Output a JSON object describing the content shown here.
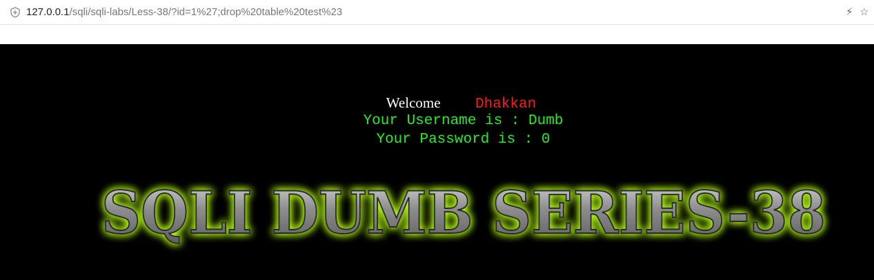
{
  "browser": {
    "url_host": "127.0.0.1",
    "url_path": "/sqli/sqli-labs/Less-38/?id=1%27;drop%20table%20test%23",
    "icons": [
      "shield-icon",
      "lightning-icon",
      "star-icon"
    ]
  },
  "page": {
    "welcome_label": "Welcome",
    "welcome_name": "Dhakkan",
    "username_line": "Your Username is : Dumb",
    "password_line": "Your Password is : 0",
    "banner_title": "SQLI DUMB SERIES-38"
  },
  "colors": {
    "background": "#000000",
    "welcome": "#ffffff",
    "name": "#ff1a1a",
    "result_text": "#22ee22",
    "banner_glow": "#b8ff1a",
    "banner_fill": "#9a9a9a"
  }
}
